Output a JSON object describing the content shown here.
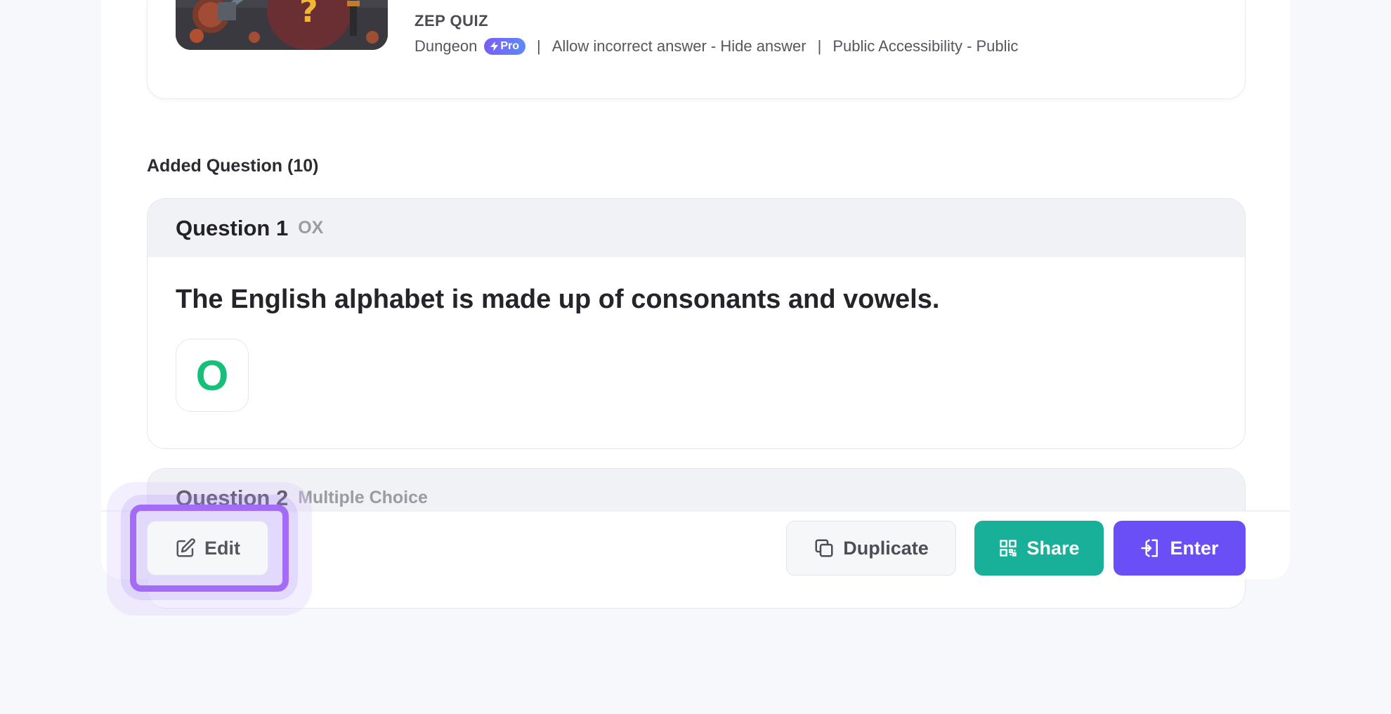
{
  "quiz": {
    "brand": "ZEP QUIZ",
    "map": "Dungeon",
    "pro_badge": "Pro",
    "separator": "|",
    "incorrect_setting": "Allow incorrect answer - Hide answer",
    "accessibility": "Public Accessibility - Public"
  },
  "questions_section": {
    "title": "Added Question (10)"
  },
  "questions": [
    {
      "number": "Question 1",
      "type": "OX",
      "text": "The English alphabet is made up of consonants and vowels.",
      "answer": "O"
    },
    {
      "number": "Question 2",
      "type": "Multiple Choice"
    }
  ],
  "footer": {
    "edit_label": "Edit",
    "duplicate_label": "Duplicate",
    "share_label": "Share",
    "enter_label": "Enter"
  },
  "colors": {
    "share": "#19b09a",
    "enter": "#6b4ff6",
    "answer_o": "#17c07a",
    "focus_ring": "#a46cf6"
  },
  "icons": {
    "edit": "edit-icon",
    "duplicate": "duplicate-icon",
    "share": "qr-code-icon",
    "enter": "enter-icon",
    "pro": "lightning-icon"
  }
}
